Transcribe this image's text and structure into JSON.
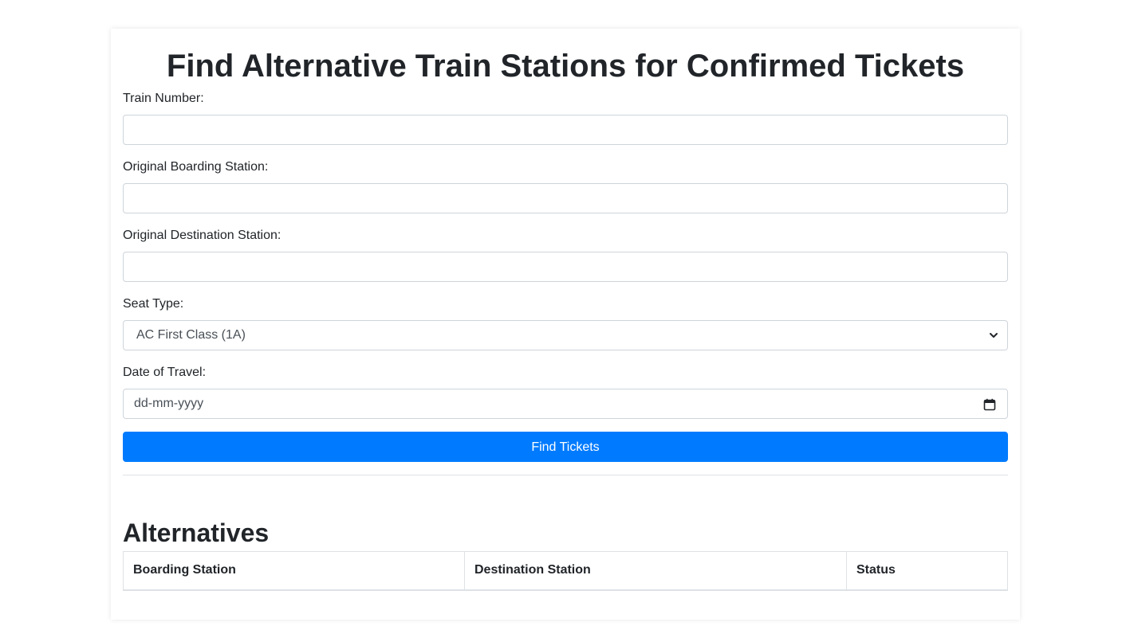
{
  "page": {
    "title": "Find Alternative Train Stations for Confirmed Tickets"
  },
  "form": {
    "train_number": {
      "label": "Train Number:",
      "value": ""
    },
    "boarding_station": {
      "label": "Original Boarding Station:",
      "value": ""
    },
    "destination_station": {
      "label": "Original Destination Station:",
      "value": ""
    },
    "seat_type": {
      "label": "Seat Type:",
      "selected": "AC First Class (1A)"
    },
    "date_of_travel": {
      "label": "Date of Travel:",
      "placeholder": "dd-mm-yyyy"
    },
    "submit_label": "Find Tickets"
  },
  "alternatives": {
    "title": "Alternatives",
    "columns": [
      "Boarding Station",
      "Destination Station",
      "Status"
    ],
    "rows": []
  },
  "colors": {
    "primary": "#007bff",
    "border": "#ced4da",
    "text": "#212529"
  },
  "icons": {
    "select_arrow": "chevron-down-icon",
    "date_picker": "calendar-icon"
  }
}
